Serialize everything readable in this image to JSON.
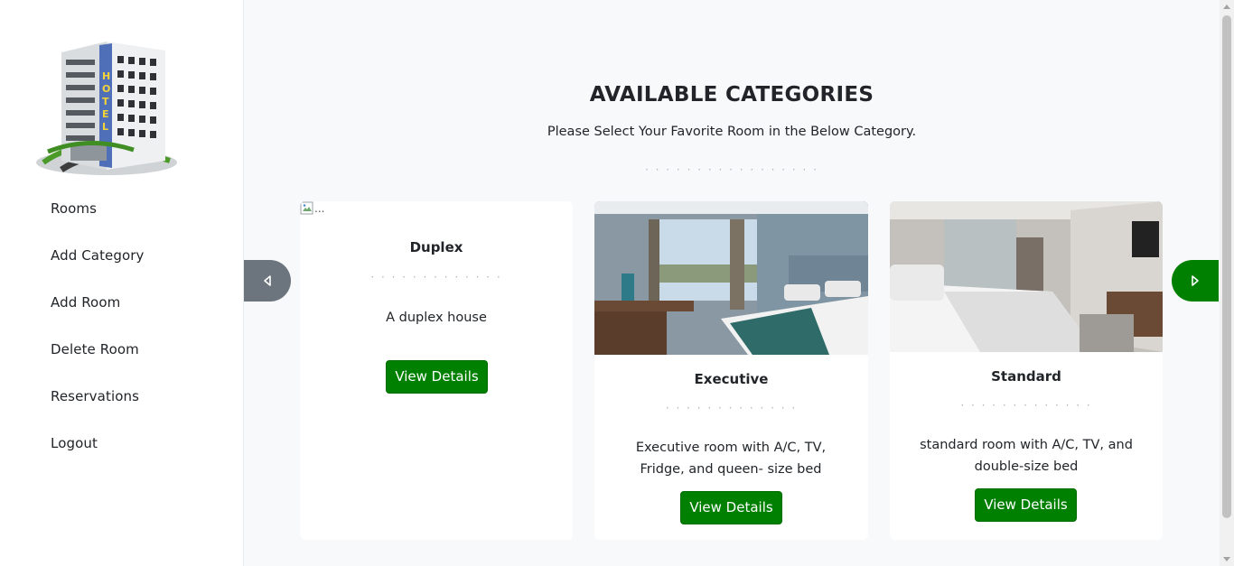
{
  "sidebar": {
    "logo_icon": "hotel-building-icon",
    "logo_text": "HOTEL",
    "items": [
      {
        "label": "Rooms"
      },
      {
        "label": "Add Category"
      },
      {
        "label": "Add Room"
      },
      {
        "label": "Delete Room"
      },
      {
        "label": "Reservations"
      },
      {
        "label": "Logout"
      }
    ]
  },
  "main": {
    "heading": "AVAILABLE CATEGORIES",
    "subheading": "Please Select Your Favorite Room in the Below Category.",
    "divider": "· · · · · · · · · · · · · · · · ·",
    "cards": [
      {
        "title": "Duplex",
        "divider": "· · · · · · · · · · · · ·",
        "description": "A duplex house",
        "image_alt": "...",
        "button_label": "View Details"
      },
      {
        "title": "Executive",
        "divider": "· · · · · · · · · · · · ·",
        "description": "Executive room with A/C, TV, Fridge, and queen- size bed",
        "button_label": "View Details"
      },
      {
        "title": "Standard",
        "divider": "· · · · · · · · · · · · ·",
        "description": "standard room with A/C, TV, and double-size bed",
        "button_label": "View Details"
      }
    ],
    "prev_icon": "caret-left-icon",
    "next_icon": "caret-right-icon"
  },
  "colors": {
    "accent_green": "#008000",
    "arrow_grey": "#6c757d",
    "background": "#f8f9fa",
    "card_background": "#ffffff"
  }
}
